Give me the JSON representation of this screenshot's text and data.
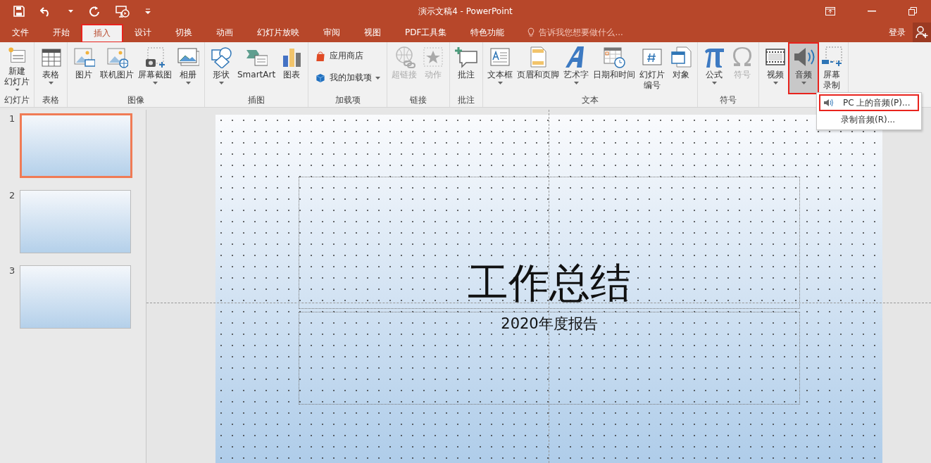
{
  "window": {
    "title": "演示文稿4 - PowerPoint"
  },
  "tabs": [
    {
      "label": "文件",
      "selected": false,
      "annotated": false
    },
    {
      "label": "开始",
      "selected": false,
      "annotated": false
    },
    {
      "label": "插入",
      "selected": true,
      "annotated": true
    },
    {
      "label": "设计",
      "selected": false,
      "annotated": false
    },
    {
      "label": "切换",
      "selected": false,
      "annotated": false
    },
    {
      "label": "动画",
      "selected": false,
      "annotated": false
    },
    {
      "label": "幻灯片放映",
      "selected": false,
      "annotated": false
    },
    {
      "label": "审阅",
      "selected": false,
      "annotated": false
    },
    {
      "label": "视图",
      "selected": false,
      "annotated": false
    },
    {
      "label": "PDF工具集",
      "selected": false,
      "annotated": false
    },
    {
      "label": "特色功能",
      "selected": false,
      "annotated": false
    }
  ],
  "tell_me": {
    "placeholder": "告诉我您想要做什么..."
  },
  "sign_in": "登录",
  "ribbon": {
    "groups": [
      {
        "label": "幻灯片",
        "buttons": [
          {
            "kind": "large",
            "lines": [
              "新建",
              "幻灯片"
            ],
            "dropdown": true,
            "disabled": false,
            "selected": false,
            "annotated": false
          }
        ]
      },
      {
        "label": "表格",
        "buttons": [
          {
            "kind": "large",
            "label": "表格",
            "dropdown": true,
            "disabled": false,
            "selected": false,
            "annotated": false
          }
        ]
      },
      {
        "label": "图像",
        "buttons": [
          {
            "kind": "large",
            "label": "图片",
            "dropdown": false,
            "disabled": false,
            "selected": false,
            "annotated": false
          },
          {
            "kind": "large",
            "label": "联机图片",
            "dropdown": false,
            "disabled": false,
            "selected": false,
            "annotated": false
          },
          {
            "kind": "large",
            "label": "屏幕截图",
            "dropdown": true,
            "disabled": false,
            "selected": false,
            "annotated": false
          },
          {
            "kind": "large",
            "label": "相册",
            "dropdown": true,
            "disabled": false,
            "selected": false,
            "annotated": false
          }
        ]
      },
      {
        "label": "插图",
        "buttons": [
          {
            "kind": "large",
            "label": "形状",
            "dropdown": true,
            "disabled": false,
            "selected": false,
            "annotated": false
          },
          {
            "kind": "large",
            "label": "SmartArt",
            "dropdown": false,
            "disabled": false,
            "selected": false,
            "annotated": false
          },
          {
            "kind": "large",
            "label": "图表",
            "dropdown": false,
            "disabled": false,
            "selected": false,
            "annotated": false
          }
        ]
      },
      {
        "label": "加载项",
        "buttons": [
          {
            "kind": "small",
            "label": "应用商店",
            "dropdown": false,
            "disabled": false,
            "selected": false,
            "annotated": false
          },
          {
            "kind": "small",
            "label": "我的加载项",
            "dropdown": true,
            "disabled": false,
            "selected": false,
            "annotated": false
          }
        ]
      },
      {
        "label": "链接",
        "buttons": [
          {
            "kind": "large",
            "label": "超链接",
            "dropdown": false,
            "disabled": true,
            "selected": false,
            "annotated": false
          },
          {
            "kind": "large",
            "label": "动作",
            "dropdown": false,
            "disabled": true,
            "selected": false,
            "annotated": false
          }
        ]
      },
      {
        "label": "批注",
        "buttons": [
          {
            "kind": "large",
            "label": "批注",
            "dropdown": false,
            "disabled": false,
            "selected": false,
            "annotated": false
          }
        ]
      },
      {
        "label": "文本",
        "buttons": [
          {
            "kind": "large",
            "label": "文本框",
            "dropdown": true,
            "disabled": false,
            "selected": false,
            "annotated": false
          },
          {
            "kind": "large",
            "label": "页眉和页脚",
            "dropdown": false,
            "disabled": false,
            "selected": false,
            "annotated": false
          },
          {
            "kind": "large",
            "label": "艺术字",
            "dropdown": true,
            "disabled": false,
            "selected": false,
            "annotated": false
          },
          {
            "kind": "large",
            "label": "日期和时间",
            "dropdown": false,
            "disabled": false,
            "selected": false,
            "annotated": false
          },
          {
            "kind": "large",
            "lines": [
              "幻灯片",
              "编号"
            ],
            "dropdown": false,
            "disabled": false,
            "selected": false,
            "annotated": false
          },
          {
            "kind": "large",
            "label": "对象",
            "dropdown": false,
            "disabled": false,
            "selected": false,
            "annotated": false
          }
        ]
      },
      {
        "label": "符号",
        "buttons": [
          {
            "kind": "large",
            "label": "公式",
            "dropdown": true,
            "disabled": false,
            "selected": false,
            "annotated": false
          },
          {
            "kind": "large",
            "label": "符号",
            "dropdown": false,
            "disabled": true,
            "selected": false,
            "annotated": false
          }
        ]
      },
      {
        "buttons": [
          {
            "kind": "large",
            "label": "视频",
            "dropdown": true,
            "disabled": false,
            "selected": false,
            "annotated": false
          },
          {
            "kind": "large",
            "label": "音频",
            "dropdown": true,
            "disabled": false,
            "selected": true,
            "annotated": true
          },
          {
            "kind": "large",
            "lines": [
              "屏幕",
              "录制"
            ],
            "dropdown": false,
            "disabled": false,
            "selected": false,
            "annotated": false
          }
        ]
      }
    ]
  },
  "audio_menu": [
    {
      "label": "PC 上的音频(P)...",
      "annotated": true
    },
    {
      "label": "录制音频(R)...",
      "annotated": false
    }
  ],
  "thumbnails": [
    {
      "number": "1",
      "selected": true
    },
    {
      "number": "2",
      "selected": false
    },
    {
      "number": "3",
      "selected": false
    }
  ],
  "slide": {
    "title": "工作总结",
    "subtitle": "2020年度报告"
  }
}
